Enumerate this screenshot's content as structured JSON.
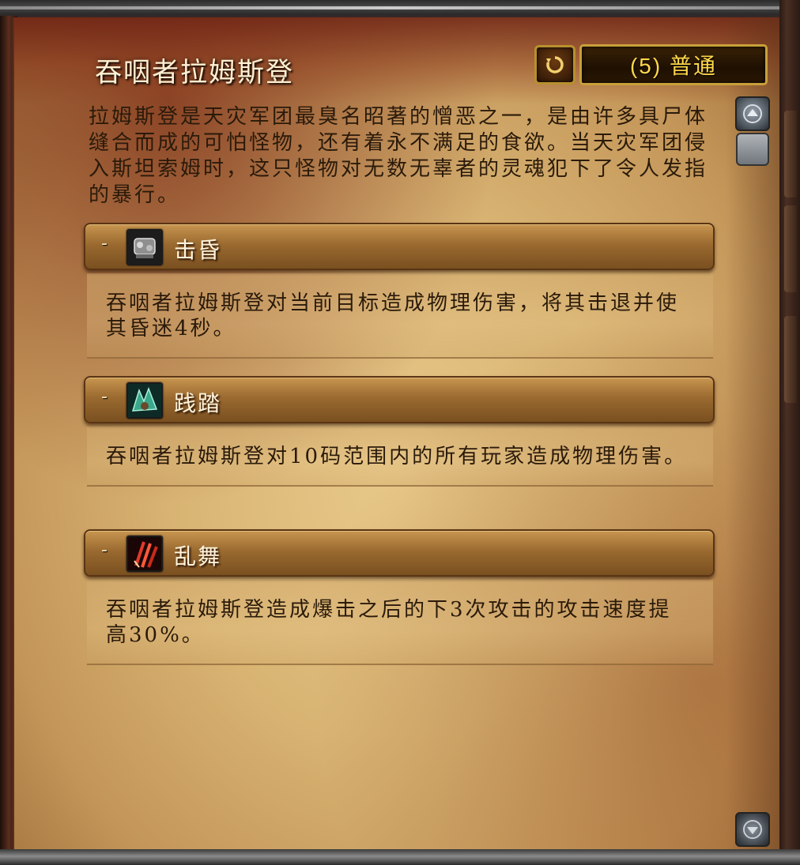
{
  "encounter": {
    "title": "吞咽者拉姆斯登",
    "difficulty_label": "(5) 普通",
    "description": "拉姆斯登是天灾军团最臭名昭著的憎恶之一，是由许多具尸体缝合而成的可怕怪物，还有着永不满足的食欲。当天灾军团侵入斯坦索姆时，这只怪物对无数无辜者的灵魂犯下了令人发指的暴行。"
  },
  "abilities": [
    {
      "collapse_glyph": "-",
      "icon": "stun-gauntlet-icon",
      "name": "击昏",
      "text": "吞咽者拉姆斯登对当前目标造成物理伤害，将其击退并使其昏迷4秒。"
    },
    {
      "collapse_glyph": "-",
      "icon": "trample-icon",
      "name": "践踏",
      "text": "吞咽者拉姆斯登对10码范围内的所有玩家造成物理伤害。"
    },
    {
      "collapse_glyph": "-",
      "icon": "claw-frenzy-icon",
      "name": "乱舞",
      "text": "吞咽者拉姆斯登造成爆击之后的下3次攻击的攻击速度提高30%。"
    }
  ],
  "icons": {
    "reset": "reset-arrow-icon",
    "scroll_up": "scroll-up-icon",
    "scroll_down": "scroll-down-icon"
  }
}
